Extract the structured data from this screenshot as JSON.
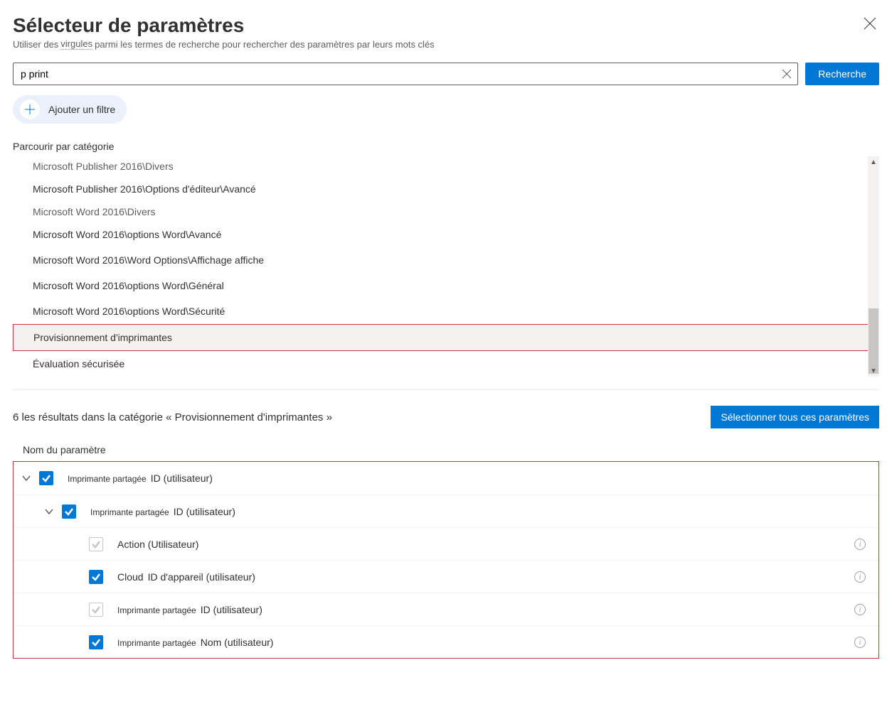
{
  "header": {
    "title": "Sélecteur de paramètres",
    "subtitle_prefix": "Utiliser des",
    "subtitle_dotted": "virgules",
    "subtitle_suffix": "parmi les termes de recherche pour rechercher des paramètres par leurs mots clés"
  },
  "search": {
    "value": "p print",
    "button": "Recherche"
  },
  "filter": {
    "add_label": "Ajouter un filtre"
  },
  "browse": {
    "header": "Parcourir par catégorie",
    "items": [
      {
        "label": "Microsoft Publisher 2016\\Divers",
        "light": true
      },
      {
        "label": "Microsoft Publisher 2016\\Options d'éditeur\\Avancé"
      },
      {
        "label": "Microsoft Word 2016\\Divers",
        "light": true
      },
      {
        "label": "Microsoft Word 2016\\options Word\\Avancé"
      },
      {
        "label": "Microsoft Word 2016\\Word Options\\Affichage affiche"
      },
      {
        "label": "Microsoft Word 2016\\options Word\\Général"
      },
      {
        "label": "Microsoft Word 2016\\options Word\\Sécurité"
      },
      {
        "label": "Provisionnement d'imprimantes",
        "selected": true
      },
      {
        "label": "Évaluation sécurisée"
      }
    ]
  },
  "results": {
    "count_text": "6 les résultats dans la catégorie « Provisionnement d'imprimantes »",
    "select_all": "Sélectionner tous ces paramètres",
    "param_header": "Nom du paramètre"
  },
  "params": [
    {
      "level": 0,
      "expandable": true,
      "checked": true,
      "prefix": "Imprimante partagée",
      "label": "ID (utilisateur)",
      "info": false
    },
    {
      "level": 1,
      "expandable": true,
      "checked": true,
      "prefix": "Imprimante partagée",
      "label": "ID (utilisateur)",
      "info": false
    },
    {
      "level": 2,
      "expandable": false,
      "checked": false,
      "prefix": "",
      "label": "Action (Utilisateur)",
      "info": true
    },
    {
      "level": 2,
      "expandable": false,
      "checked": true,
      "prefix": "Cloud",
      "label": "ID d'appareil (utilisateur)",
      "info": true,
      "prefixLarge": true
    },
    {
      "level": 2,
      "expandable": false,
      "checked": false,
      "prefix": "Imprimante partagée",
      "label": "ID (utilisateur)",
      "info": true
    },
    {
      "level": 2,
      "expandable": false,
      "checked": true,
      "prefix": "Imprimante partagée",
      "label": "Nom (utilisateur)",
      "info": true
    }
  ]
}
